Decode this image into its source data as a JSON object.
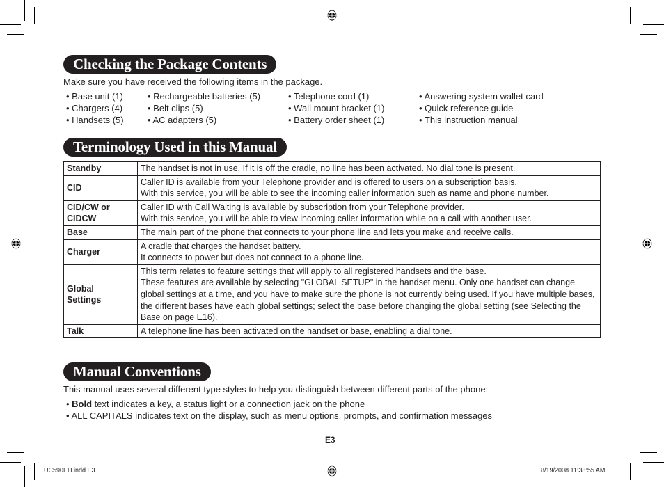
{
  "sections": {
    "package": {
      "title": "Checking the Package Contents",
      "intro": "Make sure you have received the following items in the package.",
      "columns": [
        [
          "• Base unit (1)",
          "• Chargers (4)",
          "• Handsets (5)"
        ],
        [
          "• Rechargeable batteries (5)",
          "• Belt clips (5)",
          "• AC adapters (5)"
        ],
        [
          "• Telephone cord (1)",
          "• Wall mount bracket (1)",
          "• Battery order sheet (1)"
        ],
        [
          "• Answering system wallet card",
          "• Quick reference guide",
          "• This instruction manual"
        ]
      ]
    },
    "terminology": {
      "title": "Terminology Used in this Manual",
      "rows": [
        {
          "term": "Standby",
          "definition": "The handset is not in use. If it is off the cradle, no line has been activated. No dial tone is present."
        },
        {
          "term": "CID",
          "definition": "Caller ID is available from your Telephone provider and is offered to users on a subscription basis.\nWith this service, you will be able to see the incoming caller information such as name and phone number."
        },
        {
          "term": "CID/CW or CIDCW",
          "definition": "Caller ID with Call Waiting is available by subscription from your Telephone provider.\nWith this service, you will be able to view incoming caller information while on a call with another user."
        },
        {
          "term": "Base",
          "definition": "The main part of the phone that connects to your phone line and lets you make and receive calls."
        },
        {
          "term": "Charger",
          "definition": "A cradle that charges the handset battery.\nIt connects to power but does not connect to a phone line."
        },
        {
          "term": "Global Settings",
          "definition": "This term relates to feature settings that will apply to all registered handsets and the base.\nThese features are available by selecting \"GLOBAL SETUP\" in the handset menu. Only one handset can change global settings at a time, and you have to make sure the phone is not currently being used. If you have multiple bases, the different bases have each global settings; select the base before changing the global setting (see Selecting the Base on page E16)."
        },
        {
          "term": "Talk",
          "definition": "A telephone line has been activated on the handset or base, enabling a dial tone."
        }
      ]
    },
    "conventions": {
      "title": "Manual Conventions",
      "intro": "This manual uses several different type styles to help you distinguish between different parts of the phone:",
      "items": [
        {
          "bullet": "• ",
          "bold": "Bold",
          "text": " text indicates a key, a status light or a connection jack on the phone"
        },
        {
          "bullet": "• ",
          "bold": "",
          "text": "ALL CAPITALS indicates text on the display, such as menu options, prompts, and confirmation messages"
        }
      ]
    }
  },
  "page_number": "E3",
  "slug": {
    "file": "UC590EH.indd   E3",
    "timestamp": "8/19/2008   11:38:55 AM"
  },
  "icons": {
    "registration_mark": "registration-target-icon",
    "crop_mark": "crop-mark"
  }
}
